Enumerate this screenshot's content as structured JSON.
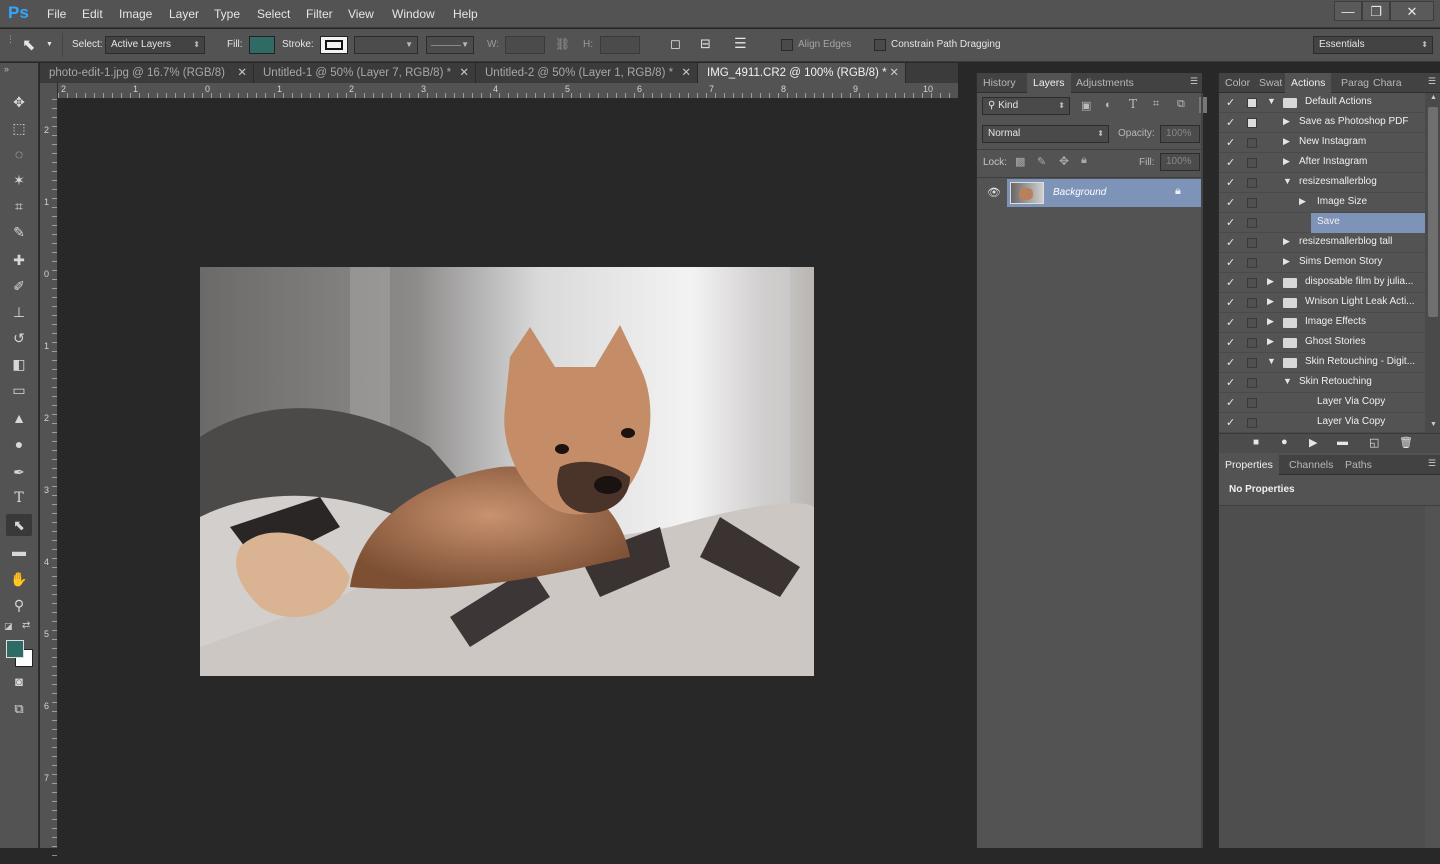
{
  "app": {
    "logo": "Ps"
  },
  "menu": [
    "File",
    "Edit",
    "Image",
    "Layer",
    "Type",
    "Select",
    "Filter",
    "View",
    "Window",
    "Help"
  ],
  "window_controls": {
    "minimize": "—",
    "restore": "❐",
    "close": "✕"
  },
  "options_bar": {
    "select_label": "Select:",
    "select_value": "Active Layers",
    "fill_label": "Fill:",
    "fill_color": "#2f6b64",
    "stroke_label": "Stroke:",
    "w_label": "W:",
    "h_label": "H:",
    "align_edges": "Align Edges",
    "constrain": "Constrain Path Dragging",
    "workspace": "Essentials"
  },
  "doc_tabs": [
    {
      "label": "photo-edit-1.jpg @ 16.7% (RGB/8)",
      "active": false
    },
    {
      "label": "Untitled-1 @ 50% (Layer 7, RGB/8) *",
      "active": false
    },
    {
      "label": "Untitled-2 @ 50% (Layer 1, RGB/8) *",
      "active": false
    },
    {
      "label": "IMG_4911.CR2 @ 100% (RGB/8) *",
      "active": true
    }
  ],
  "ruler_h": [
    "2",
    "1",
    "0",
    "1",
    "2",
    "3",
    "4",
    "5",
    "6",
    "7",
    "8",
    "9",
    "10"
  ],
  "ruler_v": [
    "2",
    "1",
    "0",
    "1",
    "2",
    "3",
    "4",
    "5",
    "6",
    "7"
  ],
  "layers_panel": {
    "tabs": [
      "History",
      "Layers",
      "Adjustments"
    ],
    "active_tab": "Layers",
    "kind_label": "Kind",
    "blend_mode": "Normal",
    "opacity_label": "Opacity:",
    "opacity_value": "100%",
    "lock_label": "Lock:",
    "fill_label": "Fill:",
    "fill_value": "100%",
    "layers": [
      {
        "name": "Background",
        "locked": true,
        "visible": true
      }
    ]
  },
  "actions_panel": {
    "tabs": [
      "Color",
      "Swat",
      "Actions",
      "Parag",
      "Chara"
    ],
    "active_tab": "Actions",
    "rows": [
      {
        "label": "Default Actions",
        "type": "set",
        "expanded": true,
        "indent": 0
      },
      {
        "label": "Save as Photoshop PDF",
        "type": "action",
        "expanded": false,
        "indent": 1
      },
      {
        "label": "New Instagram",
        "type": "action",
        "expanded": false,
        "indent": 1
      },
      {
        "label": "After Instagram",
        "type": "action",
        "expanded": false,
        "indent": 1
      },
      {
        "label": "resizesmallerblog",
        "type": "action",
        "expanded": true,
        "indent": 1
      },
      {
        "label": "Image Size",
        "type": "step",
        "expanded": false,
        "indent": 2
      },
      {
        "label": "Save",
        "type": "step-leaf",
        "expanded": false,
        "indent": 2,
        "selected": true
      },
      {
        "label": "resizesmallerblog tall",
        "type": "action",
        "expanded": false,
        "indent": 1
      },
      {
        "label": "Sims Demon Story",
        "type": "action",
        "expanded": false,
        "indent": 1
      },
      {
        "label": "disposable film by julia...",
        "type": "set",
        "expanded": false,
        "indent": 0
      },
      {
        "label": "Wnison Light Leak Acti...",
        "type": "set",
        "expanded": false,
        "indent": 0
      },
      {
        "label": "Image Effects",
        "type": "set",
        "expanded": false,
        "indent": 0
      },
      {
        "label": "Ghost Stories",
        "type": "set",
        "expanded": false,
        "indent": 0
      },
      {
        "label": "Skin Retouching - Digit...",
        "type": "set",
        "expanded": true,
        "indent": 0
      },
      {
        "label": "Skin Retouching",
        "type": "action",
        "expanded": true,
        "indent": 1
      },
      {
        "label": "Layer Via Copy",
        "type": "step-leaf",
        "expanded": false,
        "indent": 2
      },
      {
        "label": "Layer Via Copy",
        "type": "step-leaf",
        "expanded": false,
        "indent": 2
      }
    ]
  },
  "properties_panel": {
    "tabs": [
      "Properties",
      "Channels",
      "Paths"
    ],
    "active_tab": "Properties",
    "content": "No Properties"
  },
  "colors": {
    "accent_selection": "#7d93b7",
    "ps_blue": "#31a8ff"
  }
}
